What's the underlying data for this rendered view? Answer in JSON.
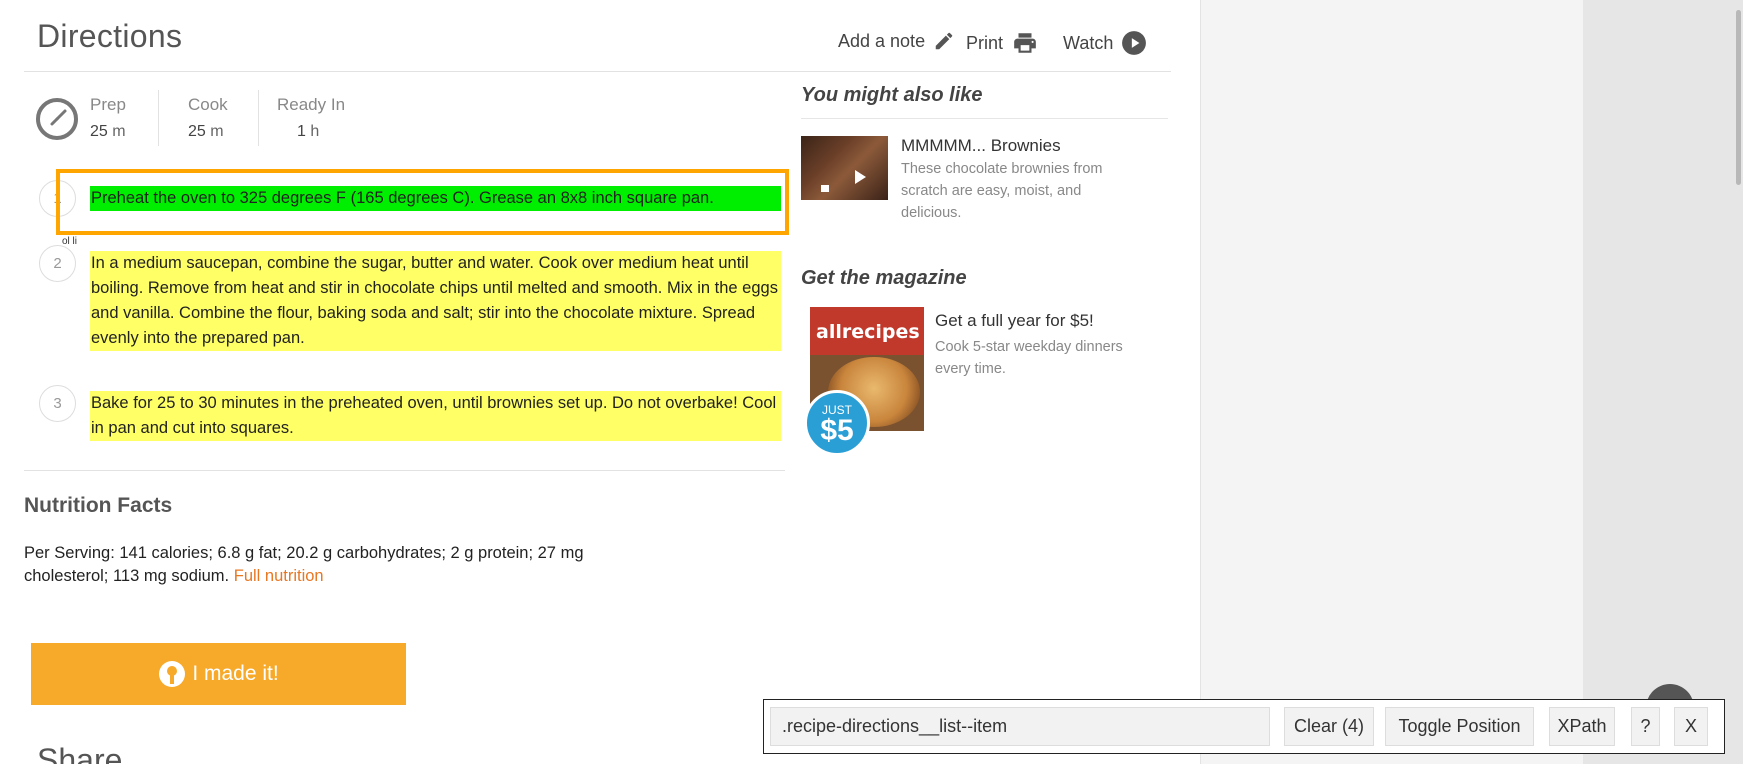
{
  "header": {
    "title": "Directions",
    "actions": {
      "add_note": "Add a note",
      "print": "Print",
      "watch": "Watch"
    }
  },
  "times": {
    "prep": {
      "label": "Prep",
      "value": "25",
      "unit": "m"
    },
    "cook": {
      "label": "Cook",
      "value": "25",
      "unit": "m"
    },
    "ready": {
      "label": "Ready In",
      "value": "1",
      "unit": "h"
    }
  },
  "steps": [
    {
      "number": "1",
      "text": "Preheat the oven to 325 degrees F (165 degrees C). Grease an 8x8 inch square pan."
    },
    {
      "number": "2",
      "text": "In a medium saucepan, combine the sugar, butter and water. Cook over medium heat until boiling. Remove from heat and stir in chocolate chips until melted and smooth. Mix in the eggs and vanilla. Combine the flour, baking soda and salt; stir into the chocolate mixture. Spread evenly into the prepared pan."
    },
    {
      "number": "3",
      "text": "Bake for 25 to 30 minutes in the preheated oven, until brownies set up. Do not overbake! Cool in pan and cut into squares."
    }
  ],
  "selection_tag": "ol li",
  "nutrition": {
    "title": "Nutrition Facts",
    "text": "Per Serving: 141 calories; 6.8 g fat; 20.2 g carbohydrates; 2 g protein; 27 mg cholesterol; 113 mg sodium.",
    "link": "Full nutrition"
  },
  "made_it": "I made it!",
  "share_title": "Share",
  "sidebar": {
    "also_like_title": "You might also like",
    "rec": {
      "title": "MMMMM... Brownies",
      "desc": "These chocolate brownies from scratch are easy, moist, and delicious."
    },
    "magazine_title": "Get the magazine",
    "magazine": {
      "brand": "allrecipes",
      "badge_top": "JUST",
      "badge_price": "$5",
      "title": "Get a full year for $5!",
      "desc": "Cook 5-star weekday dinners every time."
    }
  },
  "gadget": {
    "selector": ".recipe-directions__list--item",
    "clear": "Clear (4)",
    "toggle": "Toggle Position",
    "xpath": "XPath",
    "help": "?",
    "close": "X"
  },
  "colors": {
    "accent": "#f7a929",
    "link": "#e87722",
    "highlight_yellow": "#ffff66",
    "highlight_green": "#00ee00",
    "selection_border": "#ffa500"
  }
}
